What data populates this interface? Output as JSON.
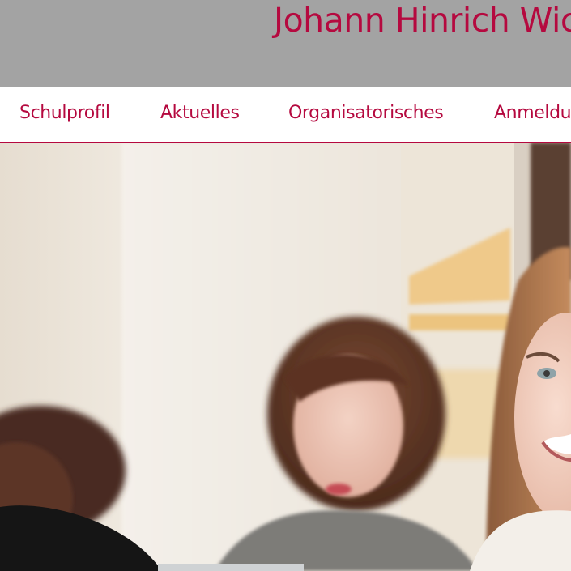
{
  "header": {
    "title": "Johann Hinrich Wic",
    "background": "#a3a3a3",
    "title_color": "#b5093f"
  },
  "nav": {
    "items": [
      {
        "label": "Schulprofil"
      },
      {
        "label": "Aktuelles"
      },
      {
        "label": "Organisatorisches"
      },
      {
        "label": "Anmeldu"
      }
    ],
    "color": "#b5093f",
    "divider_color": "#b5093f"
  },
  "hero": {
    "icon": "photo-students-in-classroom"
  }
}
